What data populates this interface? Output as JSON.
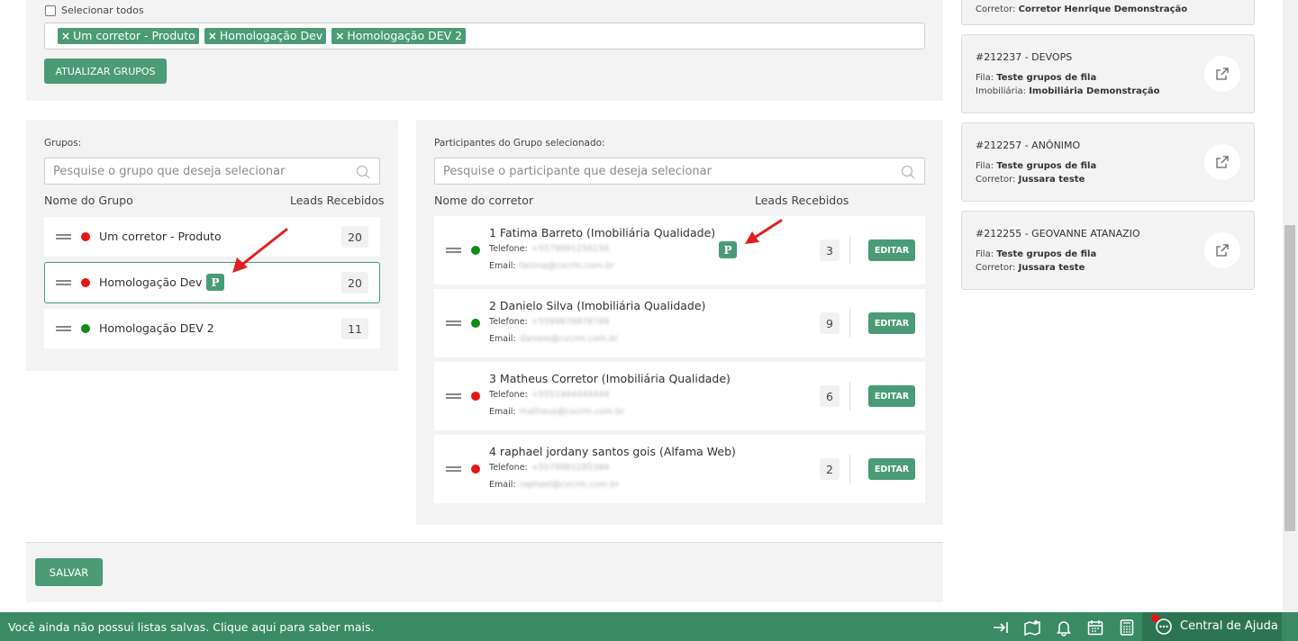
{
  "top": {
    "select_all_label": "Selecionar todos",
    "tags": [
      "Um corretor - Produto",
      "Homologação Dev",
      "Homologação DEV 2"
    ],
    "update_button": "ATUALIZAR GRUPOS"
  },
  "groups": {
    "label": "Grupos:",
    "search_placeholder": "Pesquise o grupo que deseja selecionar",
    "col_name": "Nome do Grupo",
    "col_leads": "Leads Recebidos",
    "items": [
      {
        "name": "Um corretor - Produto",
        "status": "red",
        "count": "20",
        "selected": false,
        "badge": ""
      },
      {
        "name": "Homologação Dev",
        "status": "red",
        "count": "20",
        "selected": true,
        "badge": "P"
      },
      {
        "name": "Homologação DEV 2",
        "status": "green",
        "count": "11",
        "selected": false,
        "badge": ""
      }
    ]
  },
  "participants": {
    "label": "Participantes do Grupo selecionado:",
    "search_placeholder": "Pesquise o participante que deseja selecionar",
    "col_name": "Nome do corretor",
    "col_leads": "Leads Recebidos",
    "phone_label": "Telefone:",
    "email_label": "Email:",
    "edit_label": "EDITAR",
    "items": [
      {
        "name": "1 Fatima Barreto (Imobiliária Qualidade)",
        "status": "green",
        "phone": "+5579991256156",
        "email": "fatima@cvcrm.com.br",
        "count": "3",
        "badge": "P"
      },
      {
        "name": "2 Danielo Silva (Imobiliária Qualidade)",
        "status": "green",
        "phone": "+5599876878789",
        "email": "danielo@cvcrm.com.br",
        "count": "9",
        "badge": ""
      },
      {
        "name": "3 Matheus Corretor (Imobiliária Qualidade)",
        "status": "red",
        "phone": "+5551944444444",
        "email": "matheus@cvcrm.com.br",
        "count": "6",
        "badge": ""
      },
      {
        "name": "4 raphael jordany santos gois (Alfama Web)",
        "status": "red",
        "phone": "+5579981285384",
        "email": "raphael@cvcrm.com.br",
        "count": "2",
        "badge": ""
      }
    ]
  },
  "save_button": "SALVAR",
  "cards": {
    "top_partial": {
      "label": "Corretor:",
      "value": "Corretor Henrique Demonstração"
    },
    "items": [
      {
        "title": "#212237 - DEVOPS",
        "line1_label": "Fila:",
        "line1_value": "Teste grupos de fila",
        "line2_label": "Imobiliária:",
        "line2_value": "Imobiliária Demonstração"
      },
      {
        "title": "#212257 - ANÔNIMO",
        "line1_label": "Fila:",
        "line1_value": "Teste grupos de fila",
        "line2_label": "Corretor:",
        "line2_value": "Jussara teste"
      },
      {
        "title": "#212255 - GEOVANNE ATANAZIO",
        "line1_label": "Fila:",
        "line1_value": "Teste grupos de fila",
        "line2_label": "Corretor:",
        "line2_value": "Jussara teste"
      }
    ]
  },
  "bottom_bar": {
    "message": "Você ainda não possui listas salvas. Clique aqui para saber mais.",
    "help_label": "Central de Ajuda",
    "icons": [
      "arrow-to-right-icon",
      "map-star-icon",
      "bell-icon",
      "calendar-icon",
      "calculator-icon",
      "chat-icon"
    ]
  },
  "colors": {
    "accent": "#4a9b76",
    "bar": "#3b8a66",
    "status_red": "#e81414",
    "status_green": "#138a13",
    "arrow": "#e02020"
  }
}
